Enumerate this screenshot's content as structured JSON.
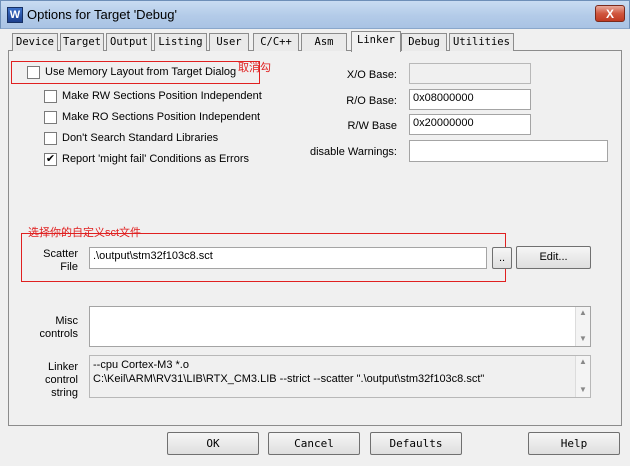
{
  "window": {
    "title": "Options for Target 'Debug'",
    "close_label": "X",
    "app_icon": "W"
  },
  "tabs": [
    "Device",
    "Target",
    "Output",
    "Listing",
    "User",
    "C/C++",
    "Asm",
    "Linker",
    "Debug",
    "Utilities"
  ],
  "active_tab": "Linker",
  "options": {
    "use_memory_layout": {
      "label": "Use Memory Layout from Target Dialog",
      "checked": false
    },
    "make_rw": {
      "label": "Make RW Sections Position Independent",
      "checked": false
    },
    "make_ro": {
      "label": "Make RO Sections Position Independent",
      "checked": false
    },
    "dont_search": {
      "label": "Don't Search Standard Libraries",
      "checked": false
    },
    "report_might_fail": {
      "label": "Report 'might fail' Conditions as Errors",
      "checked": true
    }
  },
  "check_mark": "✔",
  "bases": {
    "xo_label": "X/O Base:",
    "xo_value": "",
    "rw_label": "R/O Base:",
    "ro_value": "0x08000000",
    "rwbase_label": "R/W Base",
    "rw_value": "0x20000000",
    "warnings_label": "disable Warnings:",
    "warnings_value": ""
  },
  "annotations": {
    "uncheck_note": "取消勾",
    "choose_sct_note": "选择你的自定义sct文件"
  },
  "scatter": {
    "label_line1": "Scatter",
    "label_line2": "File",
    "value": ".\\output\\stm32f103c8.sct",
    "browse_label": "..",
    "edit_label": "Edit..."
  },
  "misc": {
    "label_line1": "Misc",
    "label_line2": "controls",
    "value": ""
  },
  "linker_control": {
    "label_line1": "Linker",
    "label_line2": "control",
    "label_line3": "string",
    "line1": "--cpu Cortex-M3 *.o",
    "line2": "C:\\Keil\\ARM\\RV31\\LIB\\RTX_CM3.LIB --strict --scatter \".\\output\\stm32f103c8.sct\""
  },
  "buttons": {
    "ok": "OK",
    "cancel": "Cancel",
    "defaults": "Defaults",
    "help": "Help"
  },
  "scroll_up": "▲",
  "scroll_down": "▼"
}
